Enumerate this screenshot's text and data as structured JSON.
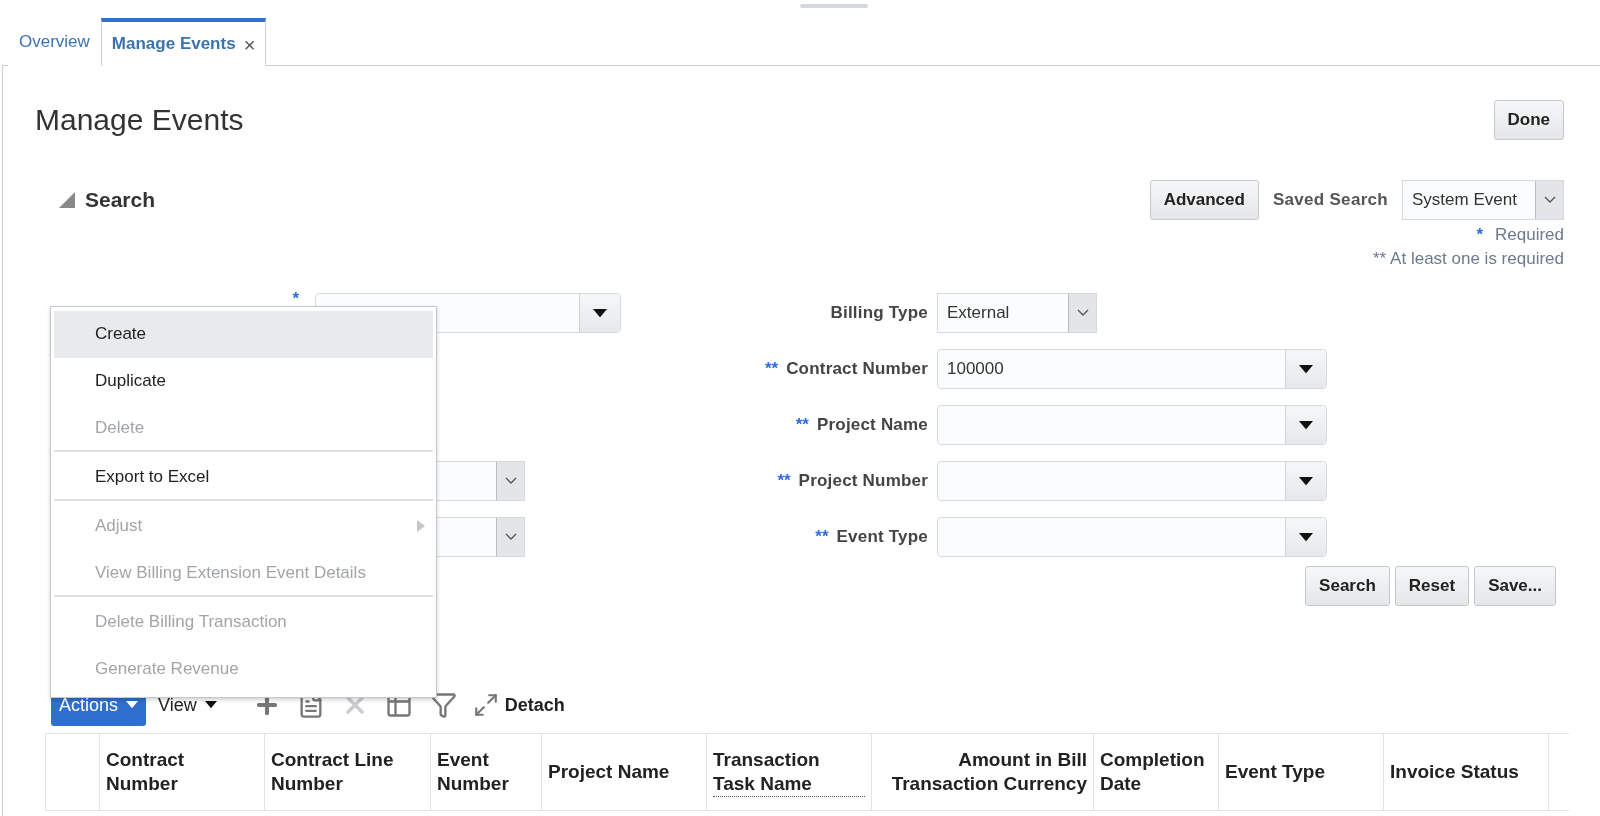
{
  "tabs": [
    {
      "label": "Overview",
      "selected": false,
      "closable": false
    },
    {
      "label": "Manage Events",
      "selected": true,
      "closable": true,
      "close_label": "×"
    }
  ],
  "page_title": "Manage Events",
  "done_button": "Done",
  "search": {
    "title": "Search",
    "expanded": true,
    "advanced_button": "Advanced",
    "saved_search": {
      "label": "Saved Search",
      "value": "System Event"
    },
    "notes": [
      {
        "marker": "*",
        "text": "Required"
      },
      {
        "marker": "**",
        "text": "At least one is required"
      }
    ],
    "left_fields": [
      {
        "kind": "lov",
        "marker": "*"
      },
      {
        "kind": "blank"
      },
      {
        "kind": "blank"
      },
      {
        "kind": "choice"
      },
      {
        "kind": "choice"
      }
    ],
    "fields": [
      {
        "label": "Billing Type",
        "kind": "choice",
        "value": "External"
      },
      {
        "label": "Contract Number",
        "kind": "lov",
        "marker": "**",
        "value": "100000"
      },
      {
        "label": "Project Name",
        "kind": "lov",
        "marker": "**"
      },
      {
        "label": "Project Number",
        "kind": "lov",
        "marker": "**"
      },
      {
        "label": "Event Type",
        "kind": "lov",
        "marker": "**"
      }
    ],
    "buttons": [
      "Search",
      "Reset",
      "Save..."
    ]
  },
  "toolbar": {
    "actions": "Actions",
    "view": "View",
    "tools": [
      {
        "kind": "add",
        "disabled": false
      },
      {
        "kind": "edit",
        "disabled": false
      },
      {
        "kind": "delete",
        "disabled": true
      },
      {
        "kind": "freeze",
        "disabled": false
      },
      {
        "kind": "filter",
        "disabled": false
      },
      {
        "kind": "detach",
        "disabled": false,
        "label": "Detach"
      }
    ]
  },
  "table": {
    "columns": [
      {
        "kind": "select"
      },
      {
        "kind": "text",
        "label": "Contract Number",
        "hint": false
      },
      {
        "kind": "text",
        "label": "Contract Line Number",
        "hint": false
      },
      {
        "kind": "text",
        "label": "Event Number",
        "hint": false
      },
      {
        "kind": "text",
        "label": "Project Name",
        "hint": false
      },
      {
        "kind": "text",
        "label": "Transaction Task Name",
        "hint": true
      },
      {
        "kind": "amount",
        "label": "Amount in Bill Transaction Currency"
      },
      {
        "kind": "text",
        "label": "Completion Date",
        "hint": false
      },
      {
        "kind": "text",
        "label": "Event Type",
        "hint": false
      },
      {
        "kind": "text",
        "label": "Invoice Status",
        "hint": false
      },
      {
        "kind": "cut"
      }
    ]
  },
  "menu": {
    "items": [
      {
        "label": "Create",
        "selected": true,
        "disabled": false,
        "submenu": false,
        "separator_after": false
      },
      {
        "label": "Duplicate",
        "selected": false,
        "disabled": false,
        "submenu": false,
        "separator_after": false
      },
      {
        "label": "Delete",
        "selected": false,
        "disabled": true,
        "submenu": false,
        "separator_after": true
      },
      {
        "label": "Export to Excel",
        "selected": false,
        "disabled": false,
        "submenu": false,
        "separator_after": true
      },
      {
        "label": "Adjust",
        "selected": false,
        "disabled": true,
        "submenu": true,
        "separator_after": false
      },
      {
        "label": "View Billing Extension Event Details",
        "selected": false,
        "disabled": true,
        "submenu": false,
        "separator_after": true
      },
      {
        "label": "Delete Billing Transaction",
        "selected": false,
        "disabled": true,
        "submenu": false,
        "separator_after": false
      },
      {
        "label": "Generate Revenue",
        "selected": false,
        "disabled": true,
        "submenu": false,
        "separator_after": false
      }
    ]
  }
}
